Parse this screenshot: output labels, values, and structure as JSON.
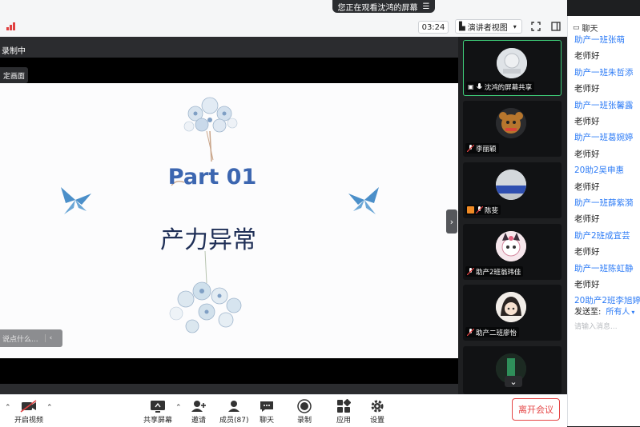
{
  "banner": {
    "text": "您正在观看沈鸿的屏幕"
  },
  "toolbar": {
    "timer": "03:24",
    "view_label": "演讲者视图"
  },
  "stage": {
    "recording_label": "录制中",
    "pin_label": "定画面",
    "slide_title": "Part  01",
    "slide_subtitle": "产力异常",
    "chat_input_placeholder": "说点什么..."
  },
  "participants": [
    {
      "name": "沈鸿的屏幕共享",
      "type": "screen-share"
    },
    {
      "name": "李丽颖",
      "type": "avatar"
    },
    {
      "name": "陈斐",
      "type": "avatar"
    },
    {
      "name": "助产2班翁玮佳",
      "type": "avatar"
    },
    {
      "name": "助产二班廖怡",
      "type": "avatar"
    },
    {
      "name": "",
      "type": "avatar"
    }
  ],
  "chat": {
    "title": "聊天",
    "messages": [
      {
        "kind": "name",
        "text": "助产一班张萌"
      },
      {
        "kind": "text",
        "text": "老师好"
      },
      {
        "kind": "name",
        "text": "助产一班朱哲添"
      },
      {
        "kind": "text",
        "text": "老师好"
      },
      {
        "kind": "name",
        "text": "助产一班张馨露"
      },
      {
        "kind": "text",
        "text": "老师好"
      },
      {
        "kind": "name",
        "text": "助产一班葛婉婷"
      },
      {
        "kind": "text",
        "text": "老师好"
      },
      {
        "kind": "name",
        "text": "20助2吴申惠"
      },
      {
        "kind": "text",
        "text": "老师好"
      },
      {
        "kind": "name",
        "text": "助产一班薛紫漪"
      },
      {
        "kind": "text",
        "text": "老师好"
      },
      {
        "kind": "name",
        "text": "助产2班成宜芸"
      },
      {
        "kind": "text",
        "text": "老师好"
      },
      {
        "kind": "name",
        "text": "助产一班陈虹静"
      },
      {
        "kind": "text",
        "text": "老师好"
      },
      {
        "kind": "name",
        "text": "20助产2班李旭婷"
      }
    ],
    "send_to_label": "发送至:",
    "send_to_value": "所有人",
    "input_placeholder": "请输入消息..."
  },
  "bottom_bar": {
    "video": "开启视频",
    "share": "共享屏幕",
    "invite": "邀请",
    "members": "成员(87)",
    "chat": "聊天",
    "record": "录制",
    "apps": "应用",
    "settings": "设置",
    "leave": "离开会议"
  },
  "colors": {
    "accent_blue": "#2e7cf6",
    "leave_red": "#e54545",
    "active_tile_border": "#3fd07a",
    "slide_title_blue": "#3c66b0"
  }
}
